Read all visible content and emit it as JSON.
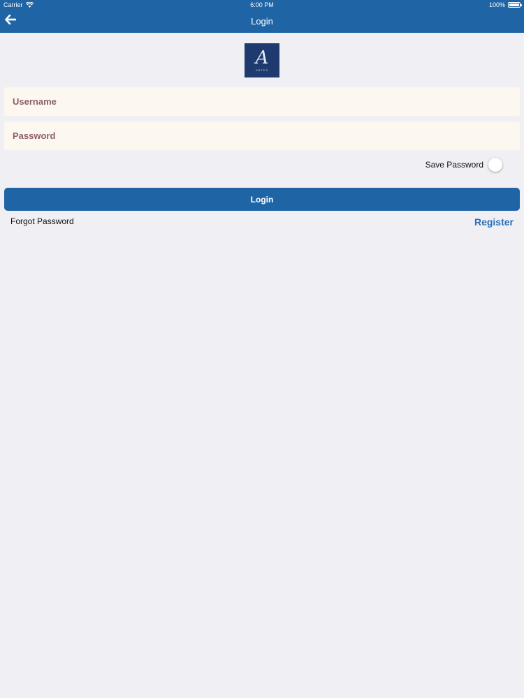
{
  "status_bar": {
    "carrier": "Carrier",
    "time": "6:00 PM",
    "battery": "100%"
  },
  "nav_bar": {
    "title": "Login",
    "back_icon": "arrow-left-icon"
  },
  "logo": {
    "mark": "A",
    "small_text": "ARTES"
  },
  "form": {
    "username_placeholder": "Username",
    "username_value": "",
    "password_placeholder": "Password",
    "password_value": "",
    "save_password_label": "Save Password",
    "save_password_on": false,
    "login_label": "Login",
    "forgot_label": "Forgot Password",
    "register_label": "Register"
  },
  "colors": {
    "accent": "#1f65a6",
    "field_bg": "#fcf8ef",
    "placeholder": "#8c5f69",
    "link": "#2a71b6",
    "page_bg": "#efeff4"
  }
}
